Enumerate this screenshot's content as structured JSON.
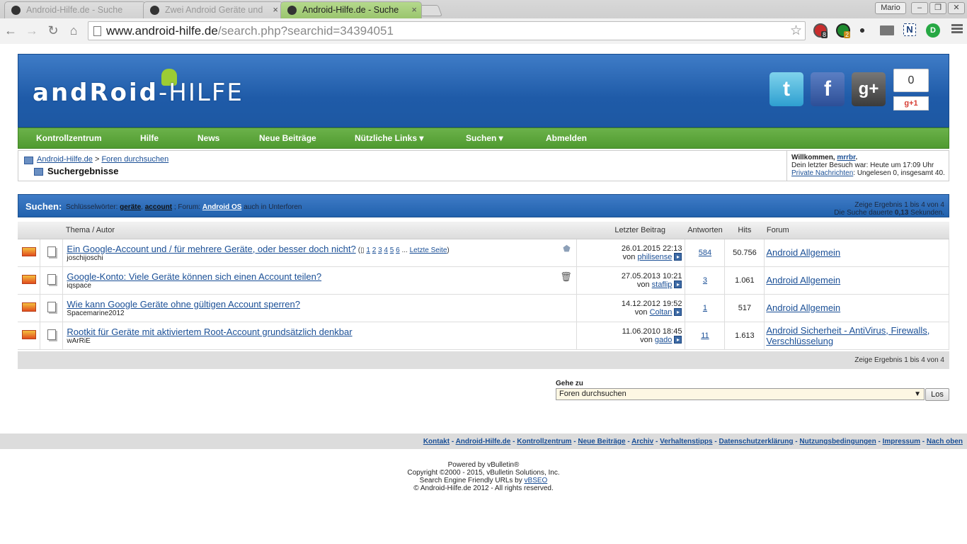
{
  "browser": {
    "tabs": [
      {
        "title": "Android-Hilfe.de - Suche"
      },
      {
        "title": "Zwei Android Geräte und"
      },
      {
        "title": "Android-Hilfe.de - Suche"
      }
    ],
    "profile_name": "Mario",
    "url_host": "www.android-hilfe.de",
    "url_rest": "/search.php?searchid=34394051",
    "ext_badges": [
      "8",
      "2"
    ]
  },
  "header": {
    "logo_left": "andRoid",
    "logo_right": "-HILFE",
    "plusone_count": "0",
    "gplus_label": "g+1"
  },
  "nav": {
    "items": [
      "Kontrollzentrum",
      "Hilfe",
      "News",
      "Neue Beiträge",
      "Nützliche Links ▾",
      "Suchen ▾",
      "Abmelden"
    ]
  },
  "breadcrumb": {
    "home": "Android-Hilfe.de",
    "sep": ">",
    "forums": "Foren durchsuchen",
    "current": "Suchergebnisse"
  },
  "welcome": {
    "greeting": "Willkommen,",
    "user": "mrrbr",
    "last_visit": "Dein letzter Besuch war: Heute um 17:09 Uhr",
    "pm_link": "Private Nachrichten",
    "pm_text": ": Ungelesen 0, insgesamt 40."
  },
  "search": {
    "heading": "Suchen:",
    "kw_label": "Schlüsselwörter:",
    "kw1": "geräte",
    "kw2": "account",
    "forum_label": "; Forum:",
    "forum": "Android OS",
    "sub": "auch in Unterforen",
    "result_line1": "Zeige Ergebnis 1 bis 4 von 4",
    "result_line2_pre": "Die Suche dauerte",
    "result_time": "0,13",
    "result_line2_post": "Sekunden."
  },
  "table": {
    "headers": [
      "Thema / Autor",
      "Letzter Beitrag",
      "Antworten",
      "Hits",
      "Forum"
    ],
    "rows": [
      {
        "title": "Ein Google-Account und / für mehrere Geräte, oder besser doch nicht?",
        "pages_open": "(",
        "pages": [
          "1",
          "2",
          "3",
          "4",
          "5",
          "6"
        ],
        "pages_sep": "...",
        "last_page": "Letzte Seite",
        "pages_close": ")",
        "author": "joschijoschi",
        "date": "26.01.2015 22:13",
        "by": "von",
        "last_user": "philisense",
        "answers": "584",
        "hits": "50.756",
        "forum": "Android Allgemein"
      },
      {
        "title": "Google-Konto: Viele Geräte können sich einen Account teilen?",
        "author": "iqspace",
        "date": "27.05.2013 10:21",
        "by": "von",
        "last_user": "staflip",
        "answers": "3",
        "hits": "1.061",
        "forum": "Android Allgemein"
      },
      {
        "title": "Wie kann Google Geräte ohne gültigen Account sperren?",
        "author": "Spacemarine2012",
        "date": "14.12.2012 19:52",
        "by": "von",
        "last_user": "Coltan",
        "answers": "1",
        "hits": "517",
        "forum": "Android Allgemein"
      },
      {
        "title": "Rootkit für Geräte mit aktiviertem Root-Account grundsätzlich denkbar",
        "author": "wArRiE",
        "date": "11.06.2010 18:45",
        "by": "von",
        "last_user": "gado",
        "answers": "11",
        "hits": "1.613",
        "forum": "Android Sicherheit - AntiVirus, Firewalls, Verschlüsselung"
      }
    ],
    "footer": "Zeige Ergebnis 1 bis 4 von 4"
  },
  "goto": {
    "label": "Gehe zu",
    "selected": "Foren durchsuchen",
    "button": "Los"
  },
  "footer": {
    "links": [
      "Kontakt",
      "Android-Hilfe.de",
      "Kontrollzentrum",
      "Neue Beiträge",
      "Archiv",
      "Verhaltenstipps",
      "Datenschutzerklärung",
      "Nutzungsbedingungen",
      "Impressum",
      "Nach oben"
    ],
    "powered": "Powered by vBulletin®",
    "copyright": "Copyright ©2000 - 2015, vBulletin Solutions, Inc.",
    "seo_pre": "Search Engine Friendly URLs by",
    "seo_link": "vBSEO",
    "rights": "© Android-Hilfe.de 2012 - All rights reserved."
  }
}
